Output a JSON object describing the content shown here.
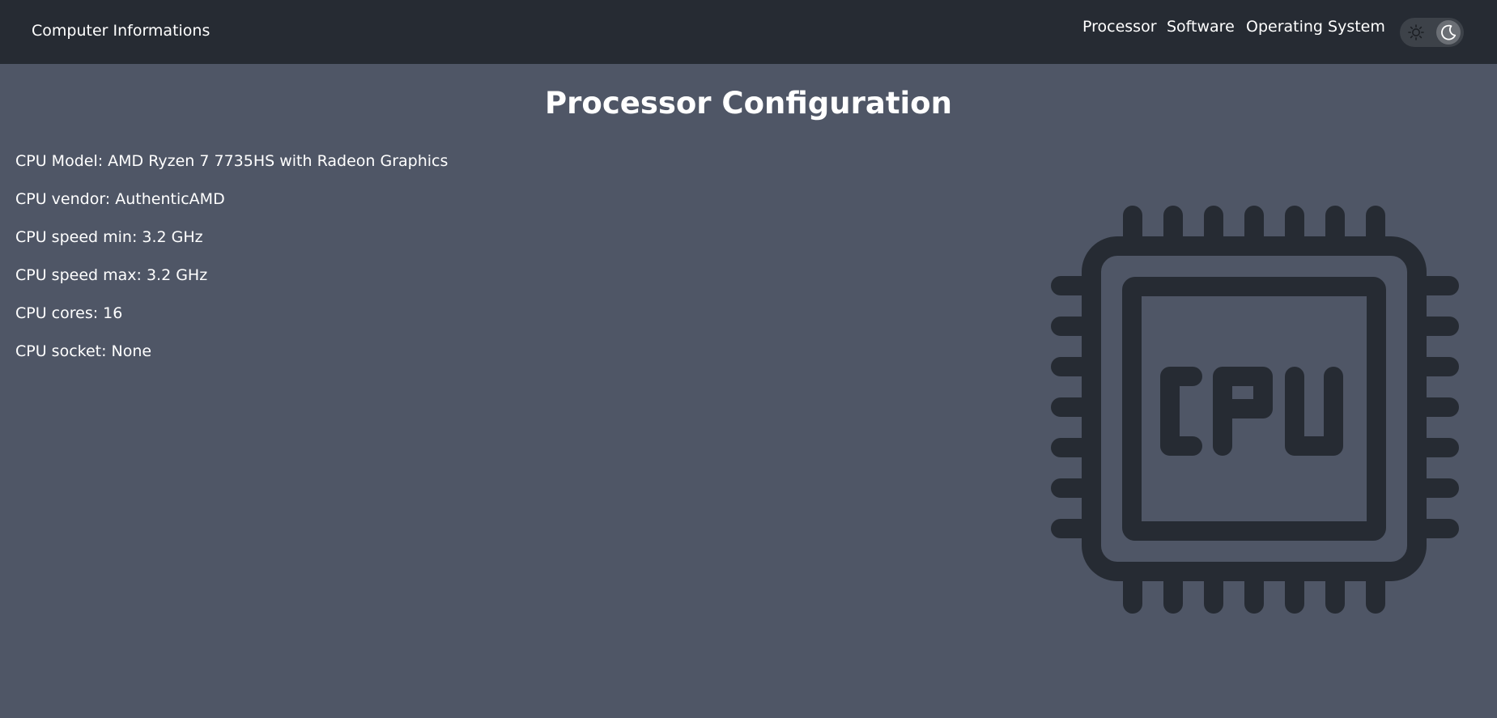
{
  "navbar": {
    "brand": "Computer Informations",
    "links": [
      {
        "label": "Processor"
      },
      {
        "label": "Software"
      },
      {
        "label": "Operating System"
      }
    ],
    "theme_toggle": {
      "mode": "dark",
      "icons": [
        "sun-icon",
        "moon-icon"
      ]
    }
  },
  "main": {
    "title": "Processor Configuration",
    "info": [
      {
        "text": "CPU Model: AMD Ryzen 7 7735HS with Radeon Graphics"
      },
      {
        "text": "CPU vendor: AuthenticAMD"
      },
      {
        "text": "CPU speed min: 3.2 GHz"
      },
      {
        "text": "CPU speed max: 3.2 GHz"
      },
      {
        "text": "CPU cores: 16"
      },
      {
        "text": "CPU socket: None"
      }
    ],
    "illustration": {
      "icon": "cpu-chip-icon",
      "label": "CPU"
    }
  },
  "colors": {
    "navbar_bg": "#262b33",
    "page_bg": "#4f5666",
    "illustration": "#262b33",
    "text": "#ffffff"
  }
}
